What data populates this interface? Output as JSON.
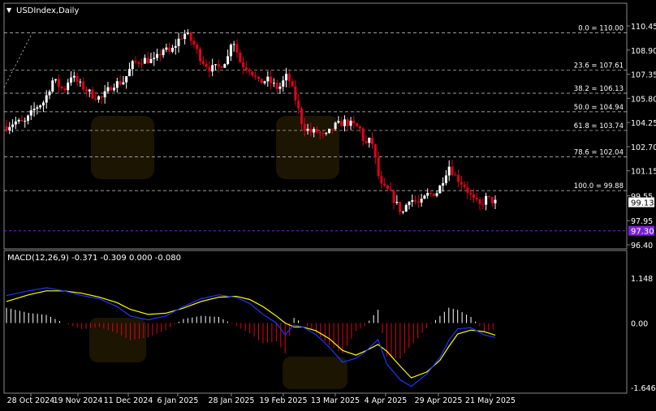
{
  "symbol_label": "USDIndex,Daily",
  "macd_label": "MACD(12,26,9) -0.371 -0.309 0.000 -0.080",
  "price_axis": [
    "110.45",
    "108.90",
    "107.35",
    "105.80",
    "104.25",
    "102.70",
    "101.15",
    "99.55",
    "97.95",
    "96.40"
  ],
  "macd_axis": [
    "1.148",
    "0.00",
    "-1.646"
  ],
  "current_price": "99.13",
  "marker_price": "97.30",
  "x_axis": [
    "28 Oct 2024",
    "19 Nov 2024",
    "11 Dec 2024",
    "6 Jan 2025",
    "28 Jan 2025",
    "19 Feb 2025",
    "13 Mar 2025",
    "4 Apr 2025",
    "29 Apr 2025",
    "21 May 2025"
  ],
  "fib_levels": [
    {
      "label": "0.0 = 110.00",
      "price": 110.0
    },
    {
      "label": "23.6 = 107.61",
      "price": 107.61
    },
    {
      "label": "38.2 = 106.13",
      "price": 106.13
    },
    {
      "label": "50.0 = 104.94",
      "price": 104.94
    },
    {
      "label": "61.8 = 103.74",
      "price": 103.74
    },
    {
      "label": "78.6 = 102.04",
      "price": 102.04
    },
    {
      "label": "100.0 = 99.88",
      "price": 99.88
    }
  ],
  "colors": {
    "bull": "#ffffff",
    "bear": "#e0001b",
    "macd_signal": "#ffff00",
    "macd_line": "#1f35ff",
    "current_tag": "#ffffff",
    "marker_tag": "#7b22d6",
    "grid": "#cfcfcf"
  },
  "chart_data": {
    "type": "candlestick",
    "ylim": [
      96.4,
      110.45
    ],
    "x_start": "2024-10-24",
    "close_path": [
      [
        "2024-10-24",
        104.0
      ],
      [
        "2024-10-28",
        104.3
      ],
      [
        "2024-11-01",
        104.2
      ],
      [
        "2024-11-06",
        105.2
      ],
      [
        "2024-11-10",
        105.6
      ],
      [
        "2024-11-14",
        107.0
      ],
      [
        "2024-11-19",
        106.3
      ],
      [
        "2024-11-22",
        107.3
      ],
      [
        "2024-11-26",
        106.7
      ],
      [
        "2024-12-02",
        106.0
      ],
      [
        "2024-12-06",
        105.8
      ],
      [
        "2024-12-11",
        106.7
      ],
      [
        "2024-12-16",
        106.9
      ],
      [
        "2024-12-20",
        108.0
      ],
      [
        "2024-12-25",
        108.3
      ],
      [
        "2024-12-30",
        108.2
      ],
      [
        "2025-01-03",
        109.0
      ],
      [
        "2025-01-06",
        108.7
      ],
      [
        "2025-01-10",
        109.6
      ],
      [
        "2025-01-13",
        110.0
      ],
      [
        "2025-01-17",
        109.2
      ],
      [
        "2025-01-20",
        108.3
      ],
      [
        "2025-01-24",
        107.7
      ],
      [
        "2025-01-28",
        107.8
      ],
      [
        "2025-02-01",
        108.4
      ],
      [
        "2025-02-03",
        109.8
      ],
      [
        "2025-02-07",
        108.0
      ],
      [
        "2025-02-11",
        107.7
      ],
      [
        "2025-02-15",
        106.8
      ],
      [
        "2025-02-19",
        107.0
      ],
      [
        "2025-02-24",
        106.4
      ],
      [
        "2025-02-28",
        107.3
      ],
      [
        "2025-03-04",
        105.6
      ],
      [
        "2025-03-07",
        104.0
      ],
      [
        "2025-03-11",
        103.6
      ],
      [
        "2025-03-13",
        103.7
      ],
      [
        "2025-03-17",
        103.3
      ],
      [
        "2025-03-21",
        104.0
      ],
      [
        "2025-03-26",
        104.3
      ],
      [
        "2025-03-31",
        104.0
      ],
      [
        "2025-04-02",
        103.8
      ],
      [
        "2025-04-04",
        102.8
      ],
      [
        "2025-04-07",
        103.2
      ],
      [
        "2025-04-11",
        100.2
      ],
      [
        "2025-04-15",
        99.8
      ],
      [
        "2025-04-21",
        98.4
      ],
      [
        "2025-04-24",
        99.4
      ],
      [
        "2025-04-29",
        99.0
      ],
      [
        "2025-05-02",
        99.6
      ],
      [
        "2025-05-07",
        99.8
      ],
      [
        "2025-05-12",
        101.5
      ],
      [
        "2025-05-15",
        100.8
      ],
      [
        "2025-05-19",
        100.2
      ],
      [
        "2025-05-23",
        99.3
      ],
      [
        "2025-05-26",
        98.9
      ],
      [
        "2025-05-29",
        99.4
      ],
      [
        "2025-06-02",
        99.13
      ]
    ],
    "macd_ylim": [
      -1.646,
      1.148
    ],
    "macd_line": [
      [
        0,
        0.7
      ],
      [
        10,
        0.82
      ],
      [
        18,
        0.9
      ],
      [
        26,
        0.82
      ],
      [
        34,
        0.7
      ],
      [
        42,
        0.62
      ],
      [
        50,
        0.42
      ],
      [
        56,
        0.18
      ],
      [
        64,
        0.08
      ],
      [
        72,
        0.18
      ],
      [
        80,
        0.42
      ],
      [
        88,
        0.62
      ],
      [
        96,
        0.72
      ],
      [
        104,
        0.65
      ],
      [
        110,
        0.5
      ],
      [
        116,
        0.22
      ],
      [
        122,
        0.0
      ],
      [
        126,
        -0.3
      ],
      [
        130,
        -0.05
      ],
      [
        134,
        -0.1
      ],
      [
        140,
        -0.3
      ],
      [
        146,
        -0.62
      ],
      [
        152,
        -1.0
      ],
      [
        158,
        -0.9
      ],
      [
        162,
        -0.75
      ],
      [
        168,
        -0.42
      ],
      [
        172,
        -1.05
      ],
      [
        178,
        -1.45
      ],
      [
        183,
        -1.62
      ],
      [
        190,
        -1.3
      ],
      [
        196,
        -0.88
      ],
      [
        200,
        -0.45
      ],
      [
        204,
        -0.15
      ],
      [
        210,
        -0.12
      ],
      [
        216,
        -0.3
      ],
      [
        221,
        -0.371
      ]
    ],
    "signal_line": [
      [
        0,
        0.55
      ],
      [
        10,
        0.72
      ],
      [
        18,
        0.82
      ],
      [
        26,
        0.82
      ],
      [
        34,
        0.76
      ],
      [
        42,
        0.66
      ],
      [
        50,
        0.52
      ],
      [
        56,
        0.35
      ],
      [
        64,
        0.22
      ],
      [
        72,
        0.25
      ],
      [
        80,
        0.38
      ],
      [
        88,
        0.55
      ],
      [
        96,
        0.66
      ],
      [
        104,
        0.68
      ],
      [
        110,
        0.6
      ],
      [
        116,
        0.42
      ],
      [
        122,
        0.18
      ],
      [
        126,
        0.0
      ],
      [
        130,
        -0.1
      ],
      [
        134,
        -0.1
      ],
      [
        140,
        -0.2
      ],
      [
        146,
        -0.4
      ],
      [
        152,
        -0.7
      ],
      [
        158,
        -0.82
      ],
      [
        162,
        -0.72
      ],
      [
        168,
        -0.55
      ],
      [
        172,
        -0.72
      ],
      [
        178,
        -1.1
      ],
      [
        183,
        -1.4
      ],
      [
        190,
        -1.25
      ],
      [
        196,
        -0.95
      ],
      [
        200,
        -0.6
      ],
      [
        204,
        -0.28
      ],
      [
        210,
        -0.18
      ],
      [
        216,
        -0.22
      ],
      [
        221,
        -0.309
      ]
    ]
  }
}
